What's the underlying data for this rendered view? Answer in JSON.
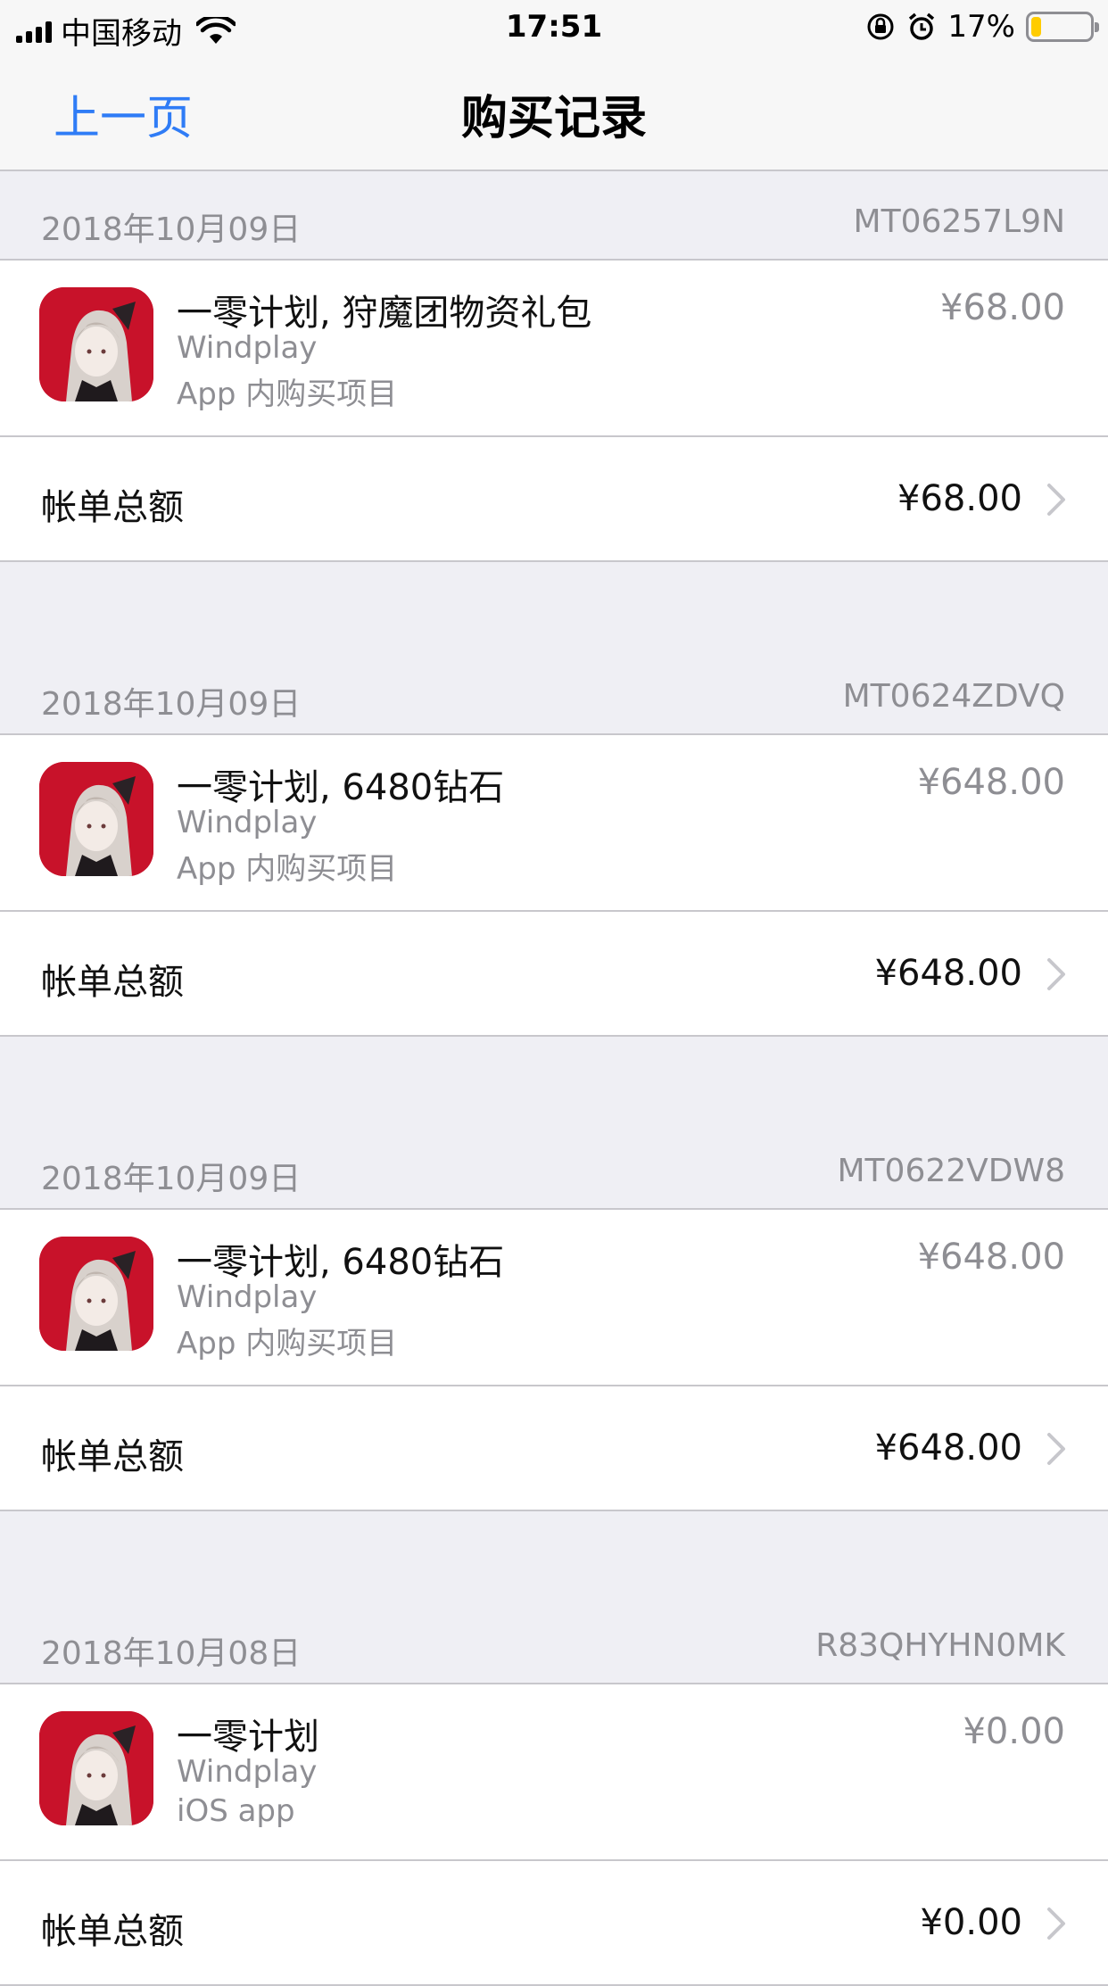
{
  "status_bar": {
    "carrier": "中国移动",
    "time": "17:51",
    "battery": "17%",
    "battery_level": 0.17,
    "icons": [
      "signal-icon",
      "wifi-icon",
      "orientation-lock-icon",
      "alarm-icon",
      "battery-icon"
    ]
  },
  "nav": {
    "back_label": "上一页",
    "title": "购买记录"
  },
  "orders": [
    {
      "date": "2018年10月09日",
      "order_id": "MT06257L9N",
      "item_title": "一零计划, 狩魔团物资礼包",
      "developer": "Windplay",
      "type": "App 内购买项目",
      "price": "¥68.00",
      "total_label": "帐单总额",
      "total": "¥68.00"
    },
    {
      "date": "2018年10月09日",
      "order_id": "MT0624ZDVQ",
      "item_title": "一零计划, 6480钻石",
      "developer": "Windplay",
      "type": "App 内购买项目",
      "price": "¥648.00",
      "total_label": "帐单总额",
      "total": "¥648.00"
    },
    {
      "date": "2018年10月09日",
      "order_id": "MT0622VDW8",
      "item_title": "一零计划, 6480钻石",
      "developer": "Windplay",
      "type": "App 内购买项目",
      "price": "¥648.00",
      "total_label": "帐单总额",
      "total": "¥648.00"
    },
    {
      "date": "2018年10月08日",
      "order_id": "R83QHYHN0MK",
      "item_title": "一零计划",
      "developer": "Windplay",
      "type": "iOS app",
      "price": "¥0.00",
      "total_label": "帐单总额",
      "total": "¥0.00"
    }
  ],
  "colors": {
    "accent": "#2f7cf6",
    "background": "#efeff4",
    "secondary_text": "#8e8e93",
    "battery_fill": "#ffcc00"
  }
}
